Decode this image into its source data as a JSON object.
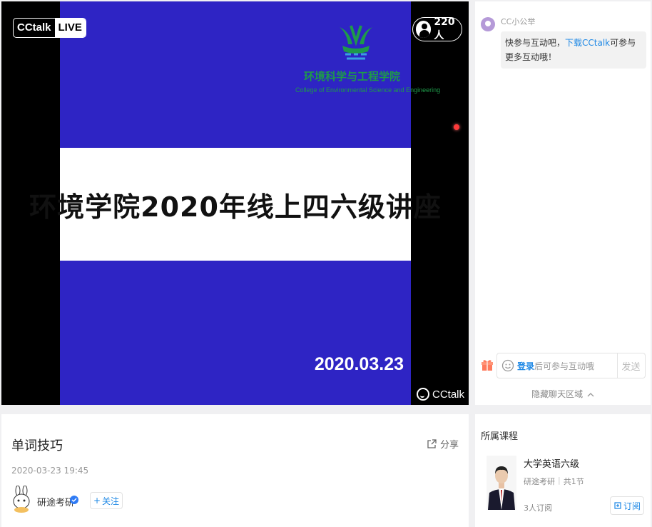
{
  "video": {
    "brand": "CCtalk",
    "live_label": "LIVE",
    "viewer_count": "220人",
    "watermark": "CCtalk",
    "slide": {
      "college_cn": "环境科学与工程学院",
      "college_en": "College of Environmental Science and Engineering",
      "title": "环境学院2020年线上四六级讲座",
      "date": "2020.03.23"
    }
  },
  "chat": {
    "message": {
      "sender": "CC小公举",
      "text_before": "快参与互动吧，",
      "link_text": "下载CCtalk",
      "text_after": "可参与更多互动哦！"
    },
    "input_login": "登录",
    "input_placeholder": "后可参与互动哦",
    "send_label": "发送",
    "hide_label": "隐藏聊天区域"
  },
  "info": {
    "title": "单词技巧",
    "share_label": "分享",
    "datetime": "2020-03-23 19:45",
    "author": "研途考研",
    "follow_label": "关注"
  },
  "course": {
    "heading": "所属课程",
    "name": "大学英语六级",
    "provider": "研途考研",
    "sections": "共1节",
    "subscribers": "3人订阅",
    "subscribe_label": "订阅"
  },
  "colors": {
    "slide_blue": "#2e24c4",
    "accent": "#1e88e5",
    "college_green": "#1e9a4a"
  }
}
